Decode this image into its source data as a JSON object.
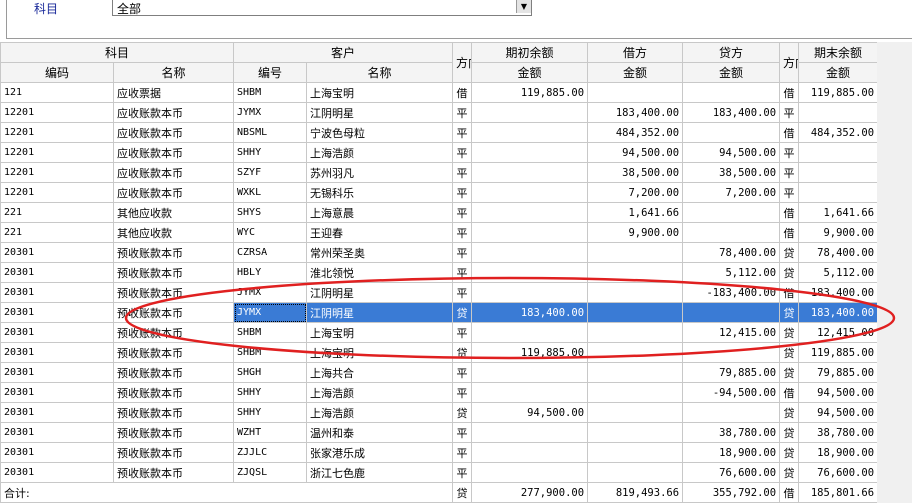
{
  "filter": {
    "label": "科目",
    "value": "全部"
  },
  "headers": {
    "subject": "科目",
    "customer": "客户",
    "direction": "方向",
    "opening": "期初余额",
    "debit": "借方",
    "credit": "贷方",
    "direction2": "方向",
    "closing": "期末余额",
    "code": "编码",
    "name": "名称",
    "cust_code": "编号",
    "cust_name": "名称",
    "amount": "金额"
  },
  "rows": [
    {
      "code": "121",
      "name": "应收票据",
      "cust_code": "SHBM",
      "cust_name": "上海宝明",
      "dir": "借",
      "opening": "119,885.00",
      "debit": "",
      "credit": "",
      "dir2": "借",
      "closing": "119,885.00"
    },
    {
      "code": "12201",
      "name": "应收账款本币",
      "cust_code": "JYMX",
      "cust_name": "江阴明星",
      "dir": "平",
      "opening": "",
      "debit": "183,400.00",
      "credit": "183,400.00",
      "dir2": "平",
      "closing": ""
    },
    {
      "code": "12201",
      "name": "应收账款本币",
      "cust_code": "NBSML",
      "cust_name": "宁波色母粒",
      "dir": "平",
      "opening": "",
      "debit": "484,352.00",
      "credit": "",
      "dir2": "借",
      "closing": "484,352.00"
    },
    {
      "code": "12201",
      "name": "应收账款本币",
      "cust_code": "SHHY",
      "cust_name": "上海浩颜",
      "dir": "平",
      "opening": "",
      "debit": "94,500.00",
      "credit": "94,500.00",
      "dir2": "平",
      "closing": ""
    },
    {
      "code": "12201",
      "name": "应收账款本币",
      "cust_code": "SZYF",
      "cust_name": "苏州羽凡",
      "dir": "平",
      "opening": "",
      "debit": "38,500.00",
      "credit": "38,500.00",
      "dir2": "平",
      "closing": ""
    },
    {
      "code": "12201",
      "name": "应收账款本币",
      "cust_code": "WXKL",
      "cust_name": "无锡科乐",
      "dir": "平",
      "opening": "",
      "debit": "7,200.00",
      "credit": "7,200.00",
      "dir2": "平",
      "closing": ""
    },
    {
      "code": "221",
      "name": "其他应收款",
      "cust_code": "SHYS",
      "cust_name": "上海意晨",
      "dir": "平",
      "opening": "",
      "debit": "1,641.66",
      "credit": "",
      "dir2": "借",
      "closing": "1,641.66"
    },
    {
      "code": "221",
      "name": "其他应收款",
      "cust_code": "WYC",
      "cust_name": "王迎春",
      "dir": "平",
      "opening": "",
      "debit": "9,900.00",
      "credit": "",
      "dir2": "借",
      "closing": "9,900.00"
    },
    {
      "code": "20301",
      "name": "预收账款本币",
      "cust_code": "CZRSA",
      "cust_name": "常州荣圣奥",
      "dir": "平",
      "opening": "",
      "debit": "",
      "credit": "78,400.00",
      "dir2": "贷",
      "closing": "78,400.00"
    },
    {
      "code": "20301",
      "name": "预收账款本币",
      "cust_code": "HBLY",
      "cust_name": "淮北领悦",
      "dir": "平",
      "opening": "",
      "debit": "",
      "credit": "5,112.00",
      "dir2": "贷",
      "closing": "5,112.00"
    },
    {
      "code": "20301",
      "name": "预收账款本币",
      "cust_code": "JYMX",
      "cust_name": "江阴明星",
      "dir": "平",
      "opening": "",
      "debit": "",
      "credit": "-183,400.00",
      "dir2": "借",
      "closing": "183,400.00"
    },
    {
      "code": "20301",
      "name": "预收账款本币",
      "cust_code": "JYMX",
      "cust_name": "江阴明星",
      "dir": "贷",
      "opening": "183,400.00",
      "debit": "",
      "credit": "",
      "dir2": "贷",
      "closing": "183,400.00",
      "selected": true
    },
    {
      "code": "20301",
      "name": "预收账款本币",
      "cust_code": "SHBM",
      "cust_name": "上海宝明",
      "dir": "平",
      "opening": "",
      "debit": "",
      "credit": "12,415.00",
      "dir2": "贷",
      "closing": "12,415.00"
    },
    {
      "code": "20301",
      "name": "预收账款本币",
      "cust_code": "SHBM",
      "cust_name": "上海宝明",
      "dir": "贷",
      "opening": "119,885.00",
      "debit": "",
      "credit": "",
      "dir2": "贷",
      "closing": "119,885.00"
    },
    {
      "code": "20301",
      "name": "预收账款本币",
      "cust_code": "SHGH",
      "cust_name": "上海共合",
      "dir": "平",
      "opening": "",
      "debit": "",
      "credit": "79,885.00",
      "dir2": "贷",
      "closing": "79,885.00"
    },
    {
      "code": "20301",
      "name": "预收账款本币",
      "cust_code": "SHHY",
      "cust_name": "上海浩颜",
      "dir": "平",
      "opening": "",
      "debit": "",
      "credit": "-94,500.00",
      "dir2": "借",
      "closing": "94,500.00"
    },
    {
      "code": "20301",
      "name": "预收账款本币",
      "cust_code": "SHHY",
      "cust_name": "上海浩颜",
      "dir": "贷",
      "opening": "94,500.00",
      "debit": "",
      "credit": "",
      "dir2": "贷",
      "closing": "94,500.00"
    },
    {
      "code": "20301",
      "name": "预收账款本币",
      "cust_code": "WZHT",
      "cust_name": "温州和泰",
      "dir": "平",
      "opening": "",
      "debit": "",
      "credit": "38,780.00",
      "dir2": "贷",
      "closing": "38,780.00"
    },
    {
      "code": "20301",
      "name": "预收账款本币",
      "cust_code": "ZJJLC",
      "cust_name": "张家港乐成",
      "dir": "平",
      "opening": "",
      "debit": "",
      "credit": "18,900.00",
      "dir2": "贷",
      "closing": "18,900.00"
    },
    {
      "code": "20301",
      "name": "预收账款本币",
      "cust_code": "ZJQSL",
      "cust_name": "浙江七色鹿",
      "dir": "平",
      "opening": "",
      "debit": "",
      "credit": "76,600.00",
      "dir2": "贷",
      "closing": "76,600.00"
    }
  ],
  "total": {
    "label": "合计:",
    "dir": "贷",
    "opening": "277,900.00",
    "debit": "819,493.66",
    "credit": "355,792.00",
    "dir2": "借",
    "closing": "185,801.66"
  },
  "annotation_color": "#e02020",
  "selection_color": "#3a7bd5"
}
